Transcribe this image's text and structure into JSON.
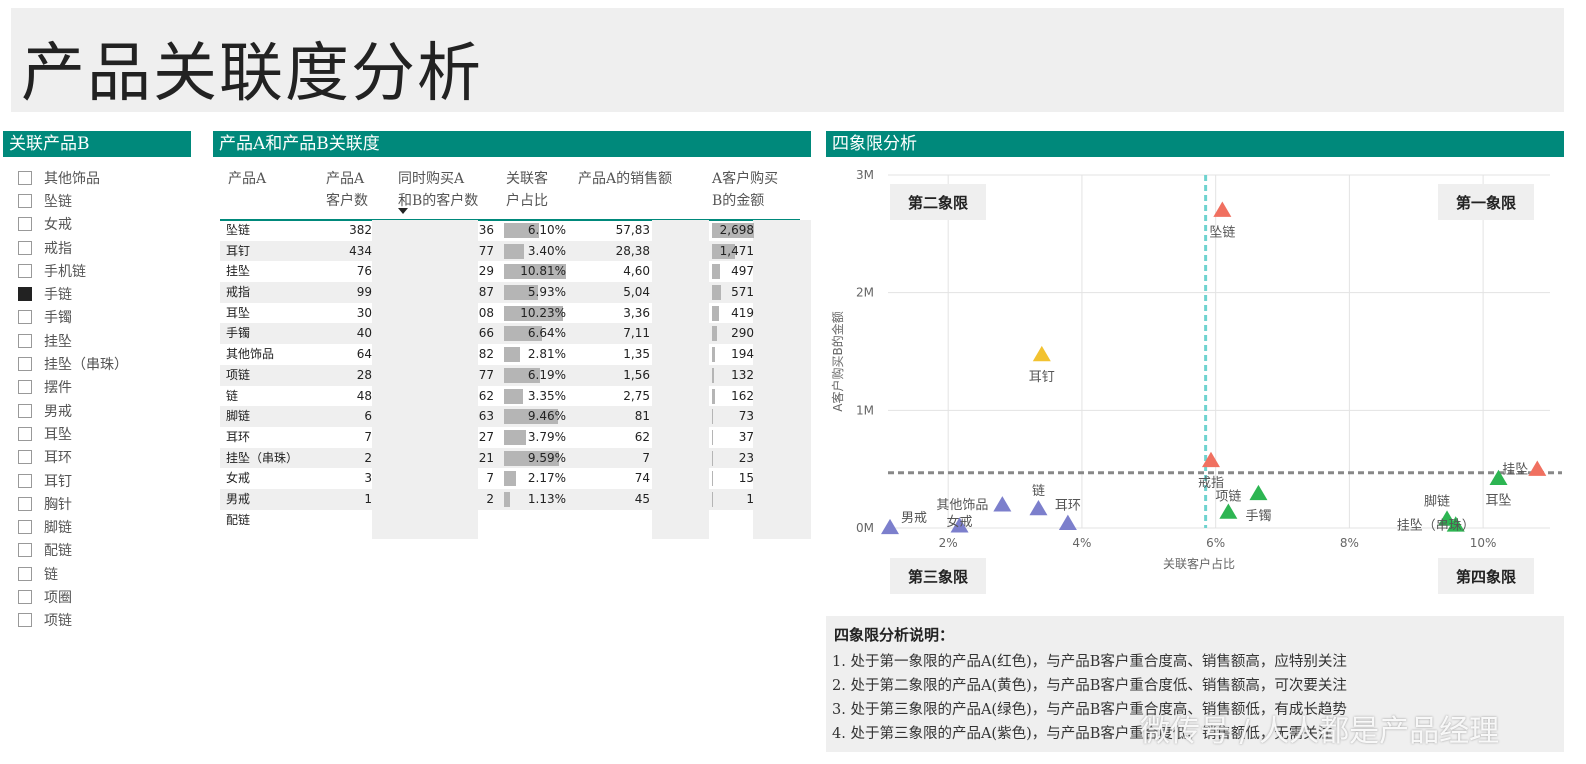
{
  "page_title": "产品关联度分析",
  "slicer": {
    "header": "关联产品B",
    "items": [
      {
        "label": "其他饰品",
        "checked": false
      },
      {
        "label": "坠链",
        "checked": false
      },
      {
        "label": "女戒",
        "checked": false
      },
      {
        "label": "戒指",
        "checked": false
      },
      {
        "label": "手机链",
        "checked": false
      },
      {
        "label": "手链",
        "checked": true
      },
      {
        "label": "手镯",
        "checked": false
      },
      {
        "label": "挂坠",
        "checked": false
      },
      {
        "label": "挂坠（串珠）",
        "checked": false
      },
      {
        "label": "摆件",
        "checked": false
      },
      {
        "label": "男戒",
        "checked": false
      },
      {
        "label": "耳坠",
        "checked": false
      },
      {
        "label": "耳环",
        "checked": false
      },
      {
        "label": "耳钉",
        "checked": false
      },
      {
        "label": "胸针",
        "checked": false
      },
      {
        "label": "脚链",
        "checked": false
      },
      {
        "label": "配链",
        "checked": false
      },
      {
        "label": "链",
        "checked": false
      },
      {
        "label": "项圈",
        "checked": false
      },
      {
        "label": "项链",
        "checked": false
      }
    ]
  },
  "table": {
    "header": "产品A和产品B关联度",
    "columns": [
      "产品A",
      "产品A\n客户数",
      "同时购买A\n和B的客户数",
      "关联客\n户占比",
      "产品A的销售额",
      "A客户购买\nB的金额"
    ],
    "rows": [
      {
        "product": "坠链",
        "cust": "382",
        "both": "36",
        "pct": "6.10%",
        "pct_v": 6.1,
        "sales": "57,83",
        "b_amt": "2,698",
        "b_v": 2698
      },
      {
        "product": "耳钉",
        "cust": "434",
        "both": "77",
        "pct": "3.40%",
        "pct_v": 3.4,
        "sales": "28,38",
        "b_amt": "1,471",
        "b_v": 1471
      },
      {
        "product": "挂坠",
        "cust": "76",
        "both": "29",
        "pct": "10.81%",
        "pct_v": 10.81,
        "sales": "4,60",
        "b_amt": "497",
        "b_v": 497
      },
      {
        "product": "戒指",
        "cust": "99",
        "both": "87",
        "pct": "5.93%",
        "pct_v": 5.93,
        "sales": "5,04",
        "b_amt": "571",
        "b_v": 571
      },
      {
        "product": "耳坠",
        "cust": "30",
        "both": "08",
        "pct": "10.23%",
        "pct_v": 10.23,
        "sales": "3,36",
        "b_amt": "419",
        "b_v": 419
      },
      {
        "product": "手镯",
        "cust": "40",
        "both": "66",
        "pct": "6.64%",
        "pct_v": 6.64,
        "sales": "7,11",
        "b_amt": "290",
        "b_v": 290
      },
      {
        "product": "其他饰品",
        "cust": "64",
        "both": "82",
        "pct": "2.81%",
        "pct_v": 2.81,
        "sales": "1,35",
        "b_amt": "194",
        "b_v": 194
      },
      {
        "product": "项链",
        "cust": "28",
        "both": "77",
        "pct": "6.19%",
        "pct_v": 6.19,
        "sales": "1,56",
        "b_amt": "132",
        "b_v": 132
      },
      {
        "product": "链",
        "cust": "48",
        "both": "62",
        "pct": "3.35%",
        "pct_v": 3.35,
        "sales": "2,75",
        "b_amt": "162",
        "b_v": 162
      },
      {
        "product": "脚链",
        "cust": "6",
        "both": "63",
        "pct": "9.46%",
        "pct_v": 9.46,
        "sales": "81",
        "b_amt": "73",
        "b_v": 73
      },
      {
        "product": "耳环",
        "cust": "7",
        "both": "27",
        "pct": "3.79%",
        "pct_v": 3.79,
        "sales": "62",
        "b_amt": "37",
        "b_v": 37
      },
      {
        "product": "挂坠（串珠）",
        "cust": "2",
        "both": "21",
        "pct": "9.59%",
        "pct_v": 9.59,
        "sales": "7",
        "b_amt": "23",
        "b_v": 23
      },
      {
        "product": "女戒",
        "cust": "3",
        "both": "7",
        "pct": "2.17%",
        "pct_v": 2.17,
        "sales": "74",
        "b_amt": "15",
        "b_v": 15
      },
      {
        "product": "男戒",
        "cust": "1",
        "both": "2",
        "pct": "1.13%",
        "pct_v": 1.13,
        "sales": "45",
        "b_amt": "1",
        "b_v": 1
      },
      {
        "product": "配链",
        "cust": "",
        "both": "",
        "pct": "",
        "pct_v": 0,
        "sales": "",
        "b_amt": "",
        "b_v": 0
      }
    ]
  },
  "quadrant": {
    "header": "四象限分析",
    "q1": "第一象限",
    "q2": "第二象限",
    "q3": "第三象限",
    "q4": "第四象限"
  },
  "chart_data": {
    "type": "scatter",
    "xlabel": "关联客户占比",
    "ylabel": "A客户购买B的金额",
    "xlim": [
      1.1,
      11.0
    ],
    "ylim": [
      0,
      3000000
    ],
    "x_ticks": [
      {
        "v": 2,
        "label": "2%"
      },
      {
        "v": 4,
        "label": "4%"
      },
      {
        "v": 6,
        "label": "6%"
      },
      {
        "v": 8,
        "label": "8%"
      },
      {
        "v": 10,
        "label": "10%"
      }
    ],
    "y_ticks": [
      {
        "v": 0,
        "label": "0M"
      },
      {
        "v": 1000000,
        "label": "1M"
      },
      {
        "v": 2000000,
        "label": "2M"
      },
      {
        "v": 3000000,
        "label": "3M"
      }
    ],
    "x_ref": 5.85,
    "y_ref": 470000,
    "colors": {
      "red": "#f07060",
      "yellow": "#f2c230",
      "green": "#2db552",
      "purple": "#7c7fcc",
      "ref_v": "#6fd3cf",
      "ref_h": "#888888"
    },
    "points": [
      {
        "label": "坠链",
        "x": 6.1,
        "y": 2698000,
        "color": "red",
        "lx": 0,
        "ly": 16
      },
      {
        "label": "耳钉",
        "x": 3.4,
        "y": 1471000,
        "color": "yellow",
        "lx": 0,
        "ly": 16
      },
      {
        "label": "戒指",
        "x": 5.93,
        "y": 571000,
        "color": "red",
        "lx": 0,
        "ly": 16
      },
      {
        "label": "挂坠",
        "x": 10.81,
        "y": 497000,
        "color": "red",
        "lx": -22,
        "ly": 0
      },
      {
        "label": "耳坠",
        "x": 10.23,
        "y": 419000,
        "color": "green",
        "lx": 0,
        "ly": 16
      },
      {
        "label": "项链",
        "x": 6.19,
        "y": 132000,
        "color": "green",
        "lx": 0,
        "ly": -16
      },
      {
        "label": "手镯",
        "x": 6.64,
        "y": 290000,
        "color": "green",
        "lx": 0,
        "ly": 16
      },
      {
        "label": "脚链",
        "x": 9.46,
        "y": 73000,
        "color": "green",
        "lx": -10,
        "ly": -18
      },
      {
        "label": "挂坠（串珠）",
        "x": 9.59,
        "y": 23000,
        "color": "green",
        "lx": -20,
        "ly": 0
      },
      {
        "label": "其他饰品",
        "x": 2.81,
        "y": 194000,
        "color": "purple",
        "lx": -40,
        "ly": 0
      },
      {
        "label": "链",
        "x": 3.35,
        "y": 162000,
        "color": "purple",
        "lx": 0,
        "ly": -18
      },
      {
        "label": "耳环",
        "x": 3.79,
        "y": 37000,
        "color": "purple",
        "lx": 0,
        "ly": -18
      },
      {
        "label": "女戒",
        "x": 2.17,
        "y": 15000,
        "color": "purple",
        "lx": 0,
        "ly": -4
      },
      {
        "label": "男戒",
        "x": 1.13,
        "y": 1000,
        "color": "purple",
        "lx": 24,
        "ly": -10
      }
    ]
  },
  "notes": {
    "title": "四象限分析说明：",
    "lines": [
      "1. 处于第一象限的产品A(红色)，与产品B客户重合度高、销售额高，应特别关注",
      "2. 处于第二象限的产品A(黄色)，与产品B客户重合度低、销售额高，可次要关注",
      "3. 处于第三象限的产品A(绿色)，与产品B客户重合度高、销售额低，有成长趋势",
      "4. 处于第三象限的产品A(紫色)，与产品B客户重合度低、销售额低，无需关注"
    ]
  },
  "watermark": "微传号 / 人人都是产品经理"
}
